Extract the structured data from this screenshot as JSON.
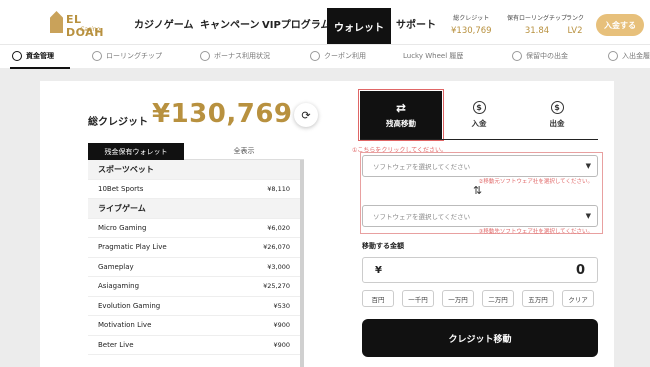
{
  "brand": {
    "name": "EL DOAH",
    "sub": "Casino"
  },
  "nav": {
    "items": [
      "カジノゲーム",
      "キャンペーン",
      "VIPプログラム",
      "ウォレット",
      "サポート"
    ],
    "active": "ウォレット"
  },
  "stats": [
    {
      "label": "総クレジット",
      "value": "¥130,769"
    },
    {
      "label": "保有ローリングチップ",
      "value": "31.84"
    },
    {
      "label": "ランク",
      "value": "LV2"
    }
  ],
  "deposit_button": "入金する",
  "subnav": [
    "資金管理",
    "ローリングチップ",
    "ボーナス利用状況",
    "クーポン利用",
    "Lucky Wheel 履歴",
    "保留中の出金",
    "入出金履"
  ],
  "credit": {
    "label": "総クレジット",
    "value": "¥130,769"
  },
  "wallet_tabs": [
    "残金保有ウォレット",
    "全表示"
  ],
  "wallets": [
    {
      "type": "section",
      "name": "スポーツベット"
    },
    {
      "type": "row",
      "name": "10Bet Sports",
      "amount": "¥8,110"
    },
    {
      "type": "section",
      "name": "ライブゲーム"
    },
    {
      "type": "row",
      "name": "Micro Gaming",
      "amount": "¥6,020"
    },
    {
      "type": "row",
      "name": "Pragmatic Play Live",
      "amount": "¥26,070"
    },
    {
      "type": "row",
      "name": "Gameplay",
      "amount": "¥3,000"
    },
    {
      "type": "row",
      "name": "Asiagaming",
      "amount": "¥25,270"
    },
    {
      "type": "row",
      "name": "Evolution Gaming",
      "amount": "¥530"
    },
    {
      "type": "row",
      "name": "Motivation Live",
      "amount": "¥900"
    },
    {
      "type": "row",
      "name": "Beter Live",
      "amount": "¥900"
    }
  ],
  "transfer_tabs": [
    "残高移動",
    "入金",
    "出金"
  ],
  "hint": "①こちらをクリックしてください。",
  "select_from": {
    "placeholder": "ソフトウェアを選択してください",
    "warning": "②移動元ソフトウェア社を選択してください。"
  },
  "select_to": {
    "placeholder": "ソフトウェアを選択してください",
    "warning": "③移動先ソフトウェア社を選択してください。"
  },
  "amount": {
    "label": "移動する金額",
    "currency": "¥",
    "value": "0"
  },
  "quick_amounts": [
    "百円",
    "一千円",
    "一万円",
    "二万円",
    "五万円",
    "クリア"
  ],
  "transfer_button": "クレジット移動"
}
